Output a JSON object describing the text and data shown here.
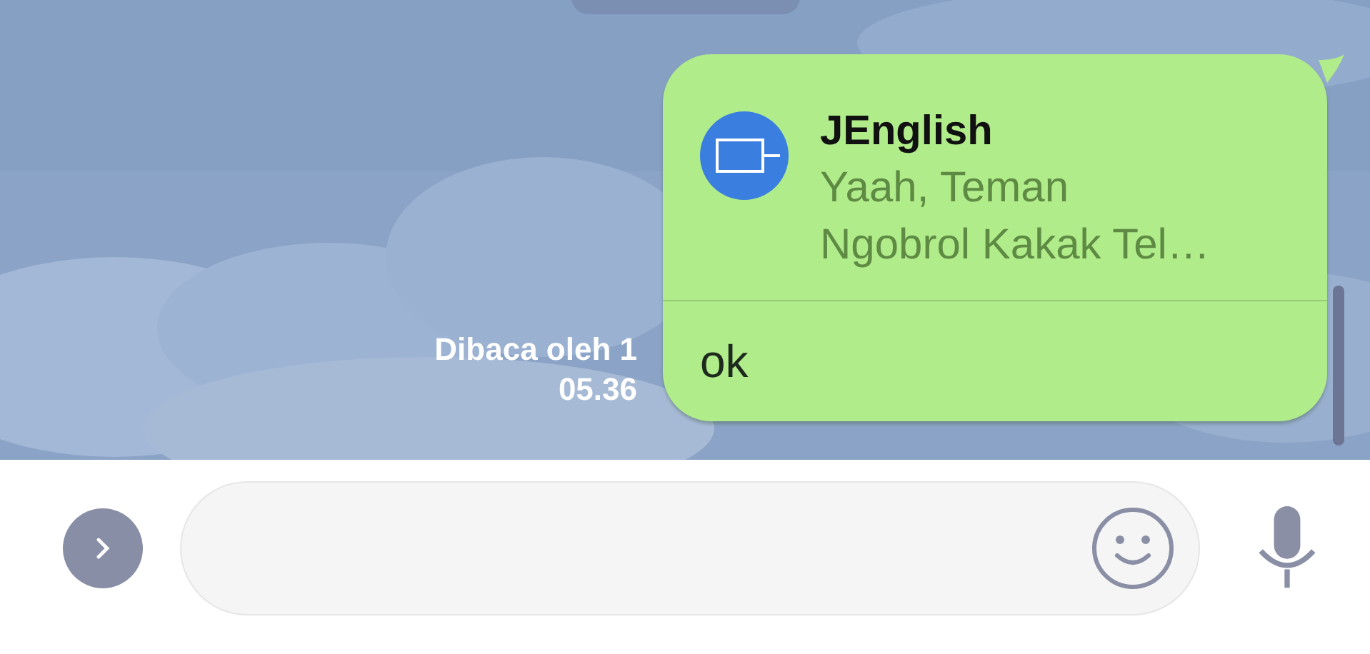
{
  "message": {
    "read_status": "Dibaca oleh 1",
    "time": "05.36",
    "shared_card": {
      "title": "JEnglish",
      "description_lines": [
        "Yaah, Teman",
        "Ngobrol Kakak Tel…"
      ]
    },
    "text": "ok"
  }
}
